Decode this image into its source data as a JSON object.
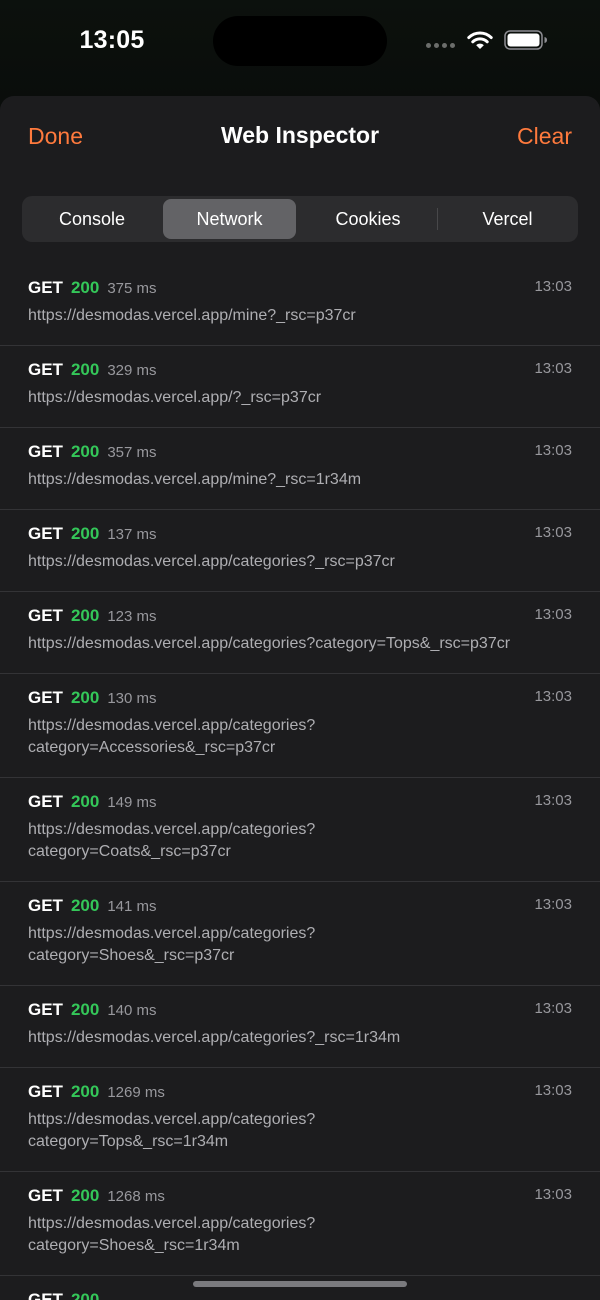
{
  "status_bar": {
    "time": "13:05",
    "icons": [
      "cellular-signal-icon",
      "wifi-icon",
      "battery-icon"
    ]
  },
  "header": {
    "done_label": "Done",
    "title": "Web Inspector",
    "clear_label": "Clear"
  },
  "tabs": [
    {
      "label": "Console",
      "selected": false
    },
    {
      "label": "Network",
      "selected": true
    },
    {
      "label": "Cookies",
      "selected": false
    },
    {
      "label": "Vercel",
      "selected": false
    }
  ],
  "colors": {
    "accent": "#ff7a3d",
    "status_success": "#34c759",
    "background": "#1c1c1e"
  },
  "requests": [
    {
      "method": "GET",
      "status": "200",
      "duration": "375 ms",
      "time": "13:03",
      "url": "https://desmodas.vercel.app/mine?_rsc=p37cr"
    },
    {
      "method": "GET",
      "status": "200",
      "duration": "329 ms",
      "time": "13:03",
      "url": "https://desmodas.vercel.app/?_rsc=p37cr"
    },
    {
      "method": "GET",
      "status": "200",
      "duration": "357 ms",
      "time": "13:03",
      "url": "https://desmodas.vercel.app/mine?_rsc=1r34m"
    },
    {
      "method": "GET",
      "status": "200",
      "duration": "137 ms",
      "time": "13:03",
      "url": "https://desmodas.vercel.app/categories?_rsc=p37cr"
    },
    {
      "method": "GET",
      "status": "200",
      "duration": "123 ms",
      "time": "13:03",
      "url": "https://desmodas.vercel.app/categories?category=Tops&_rsc=p37cr"
    },
    {
      "method": "GET",
      "status": "200",
      "duration": "130 ms",
      "time": "13:03",
      "url": "https://desmodas.vercel.app/categories?\ncategory=Accessories&_rsc=p37cr"
    },
    {
      "method": "GET",
      "status": "200",
      "duration": "149 ms",
      "time": "13:03",
      "url": "https://desmodas.vercel.app/categories?\ncategory=Coats&_rsc=p37cr"
    },
    {
      "method": "GET",
      "status": "200",
      "duration": "141 ms",
      "time": "13:03",
      "url": "https://desmodas.vercel.app/categories?\ncategory=Shoes&_rsc=p37cr"
    },
    {
      "method": "GET",
      "status": "200",
      "duration": "140 ms",
      "time": "13:03",
      "url": "https://desmodas.vercel.app/categories?_rsc=1r34m"
    },
    {
      "method": "GET",
      "status": "200",
      "duration": "1269 ms",
      "time": "13:03",
      "url": "https://desmodas.vercel.app/categories?\ncategory=Tops&_rsc=1r34m"
    },
    {
      "method": "GET",
      "status": "200",
      "duration": "1268 ms",
      "time": "13:03",
      "url": "https://desmodas.vercel.app/categories?\ncategory=Shoes&_rsc=1r34m"
    },
    {
      "method": "GET",
      "status": "200",
      "duration": "",
      "time": "",
      "url": ""
    }
  ]
}
